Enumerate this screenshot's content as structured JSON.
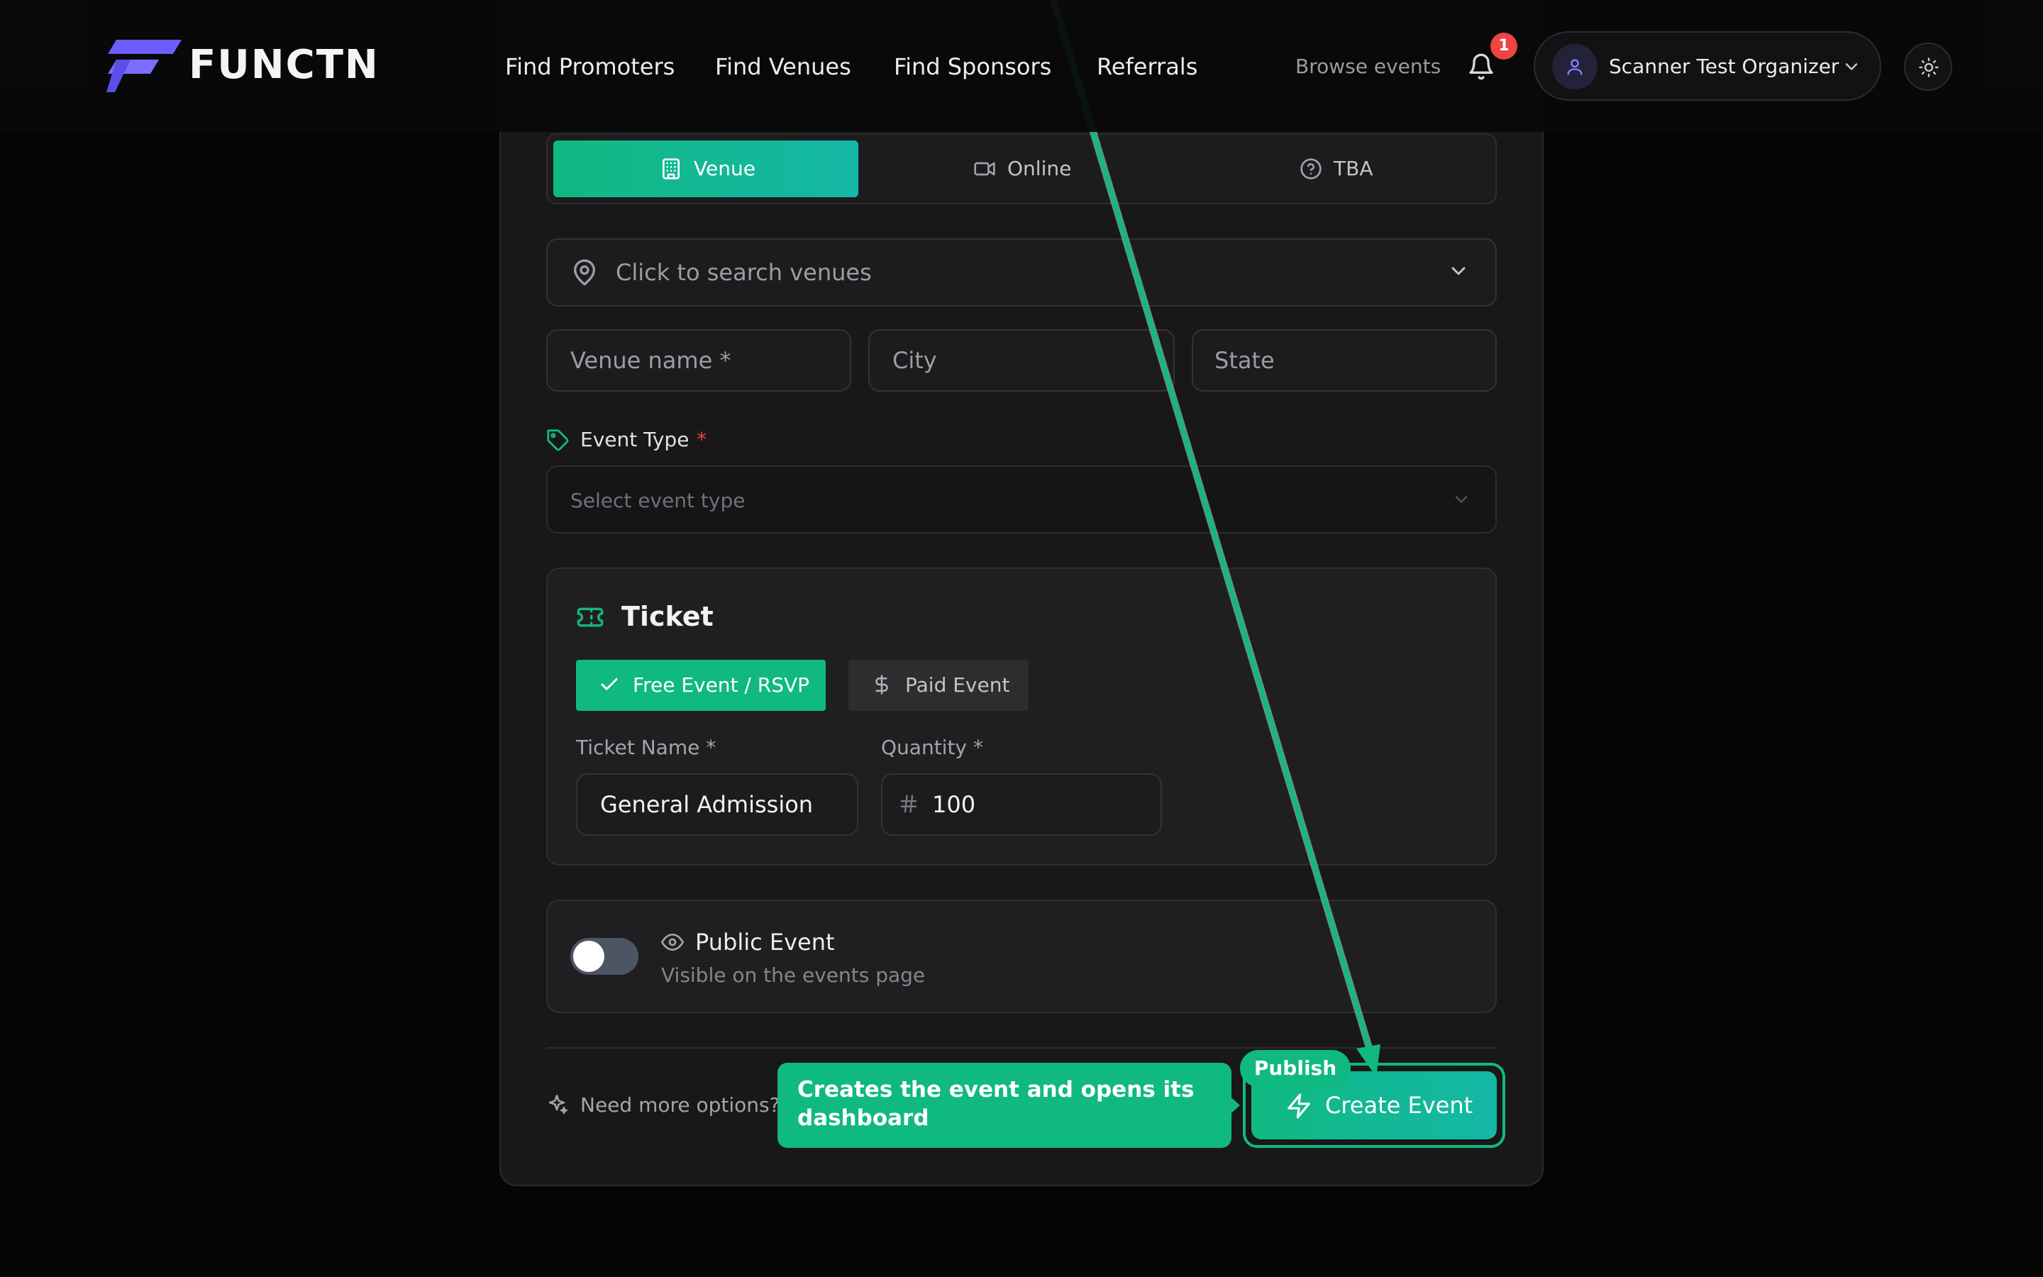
{
  "brand": {
    "name": "FUNCTN",
    "accent": "#10b981",
    "logo_color": "#6d5dfc"
  },
  "nav": {
    "items": [
      "Find Promoters",
      "Find Venues",
      "Find Sponsors",
      "Referrals"
    ]
  },
  "header": {
    "browse_label": "Browse events",
    "notification_count": "1",
    "user_name": "Scanner Test Organizer"
  },
  "location": {
    "tabs": [
      {
        "label": "Venue",
        "icon": "building-icon"
      },
      {
        "label": "Online",
        "icon": "video-icon"
      },
      {
        "label": "TBA",
        "icon": "help-circle-icon"
      }
    ],
    "selected": "Venue",
    "search_placeholder": "Click to search venues",
    "venue_name_placeholder": "Venue name *",
    "city_placeholder": "City",
    "state_placeholder": "State"
  },
  "event_type": {
    "label": "Event Type",
    "required_mark": "*",
    "placeholder": "Select event type"
  },
  "ticket": {
    "title": "Ticket",
    "free_label": "Free Event / RSVP",
    "paid_label": "Paid Event",
    "name_label": "Ticket Name *",
    "name_value": "General Admission",
    "quantity_label": "Quantity *",
    "quantity_value": "100"
  },
  "public_event": {
    "title": "Public Event",
    "subtitle": "Visible on the events page",
    "enabled": false
  },
  "footer": {
    "hint": "Need more options? S",
    "create_label": "Create Event",
    "publish_tag": "Publish",
    "callout": "Creates the event and opens its dashboard"
  }
}
